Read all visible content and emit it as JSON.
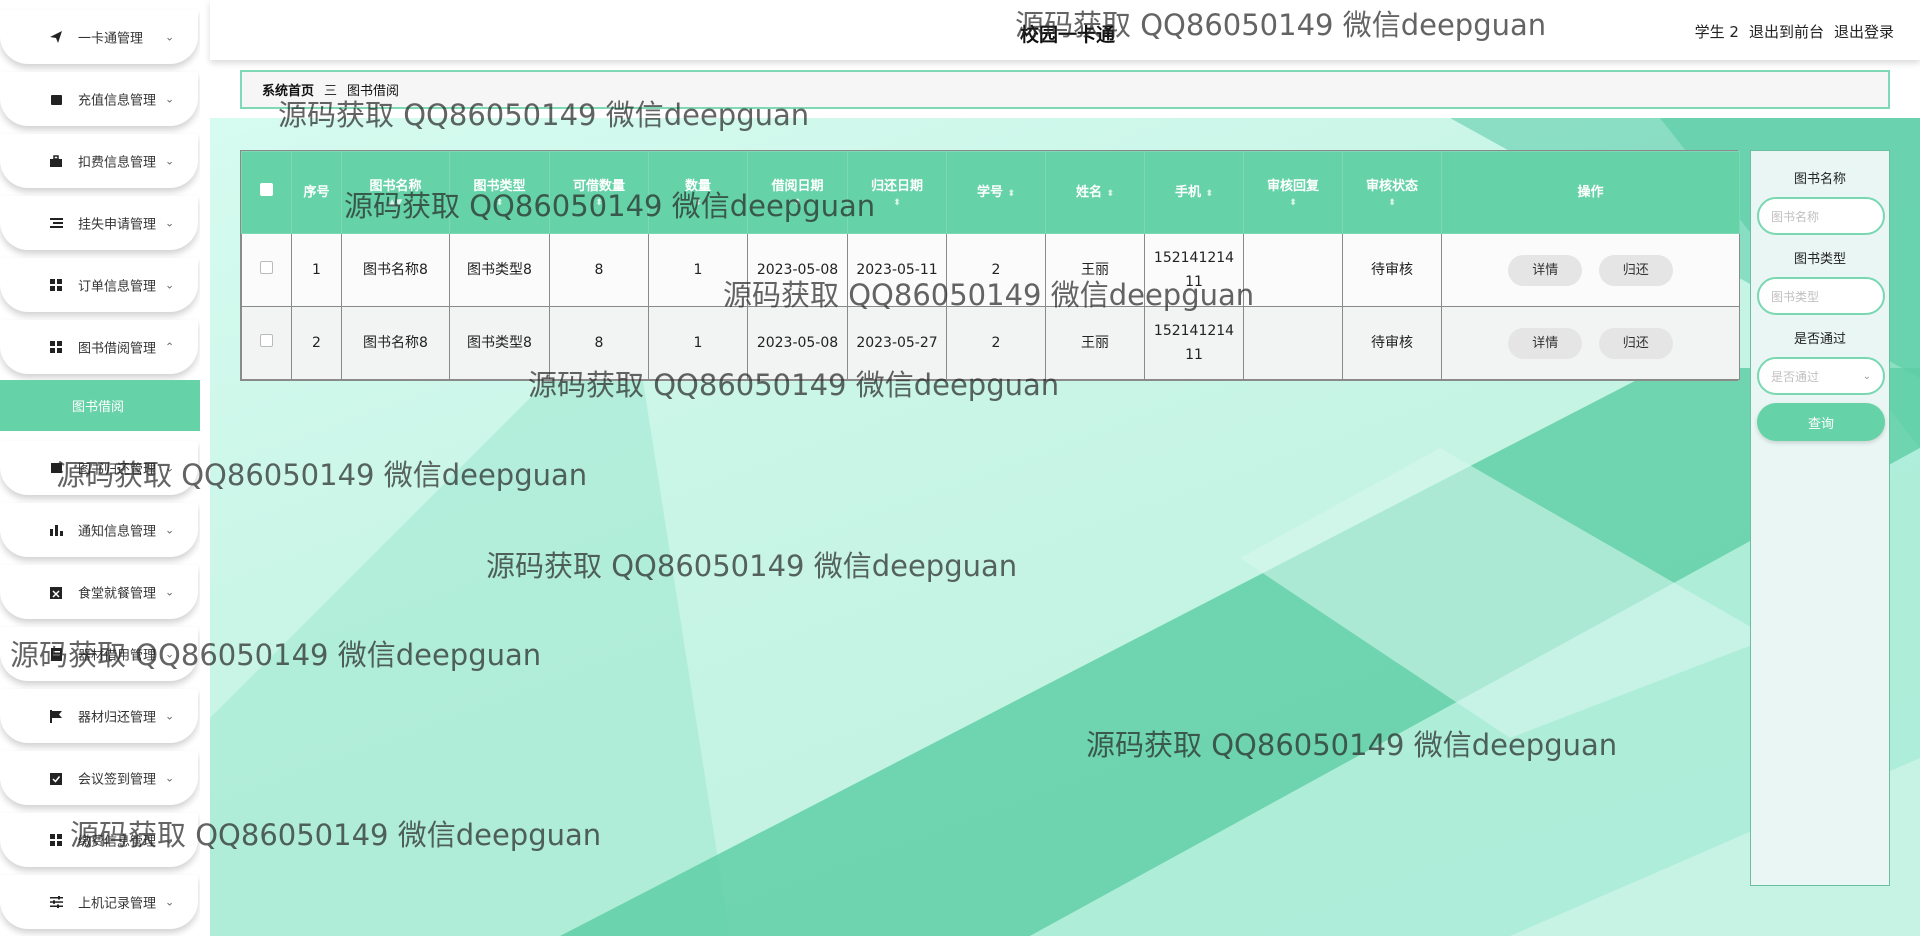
{
  "header": {
    "title": "校园一卡通",
    "user": "学生 2",
    "to_front": "退出到前台",
    "logout": "退出登录"
  },
  "sidebar": {
    "items": [
      {
        "label": "一卡通管理",
        "icon": "send-icon",
        "chevron": "v"
      },
      {
        "label": "充值信息管理",
        "icon": "wallet-icon",
        "chevron": "v"
      },
      {
        "label": "扣费信息管理",
        "icon": "briefcase-icon",
        "chevron": "v"
      },
      {
        "label": "挂失申请管理",
        "icon": "list-icon",
        "chevron": "v"
      },
      {
        "label": "订单信息管理",
        "icon": "grid-icon",
        "chevron": "v"
      },
      {
        "label": "图书借阅管理",
        "icon": "grid-icon",
        "chevron": "^"
      },
      {
        "label": "图书归还管理",
        "icon": "book-icon",
        "chevron": "v"
      },
      {
        "label": "通知信息管理",
        "icon": "bar-chart-icon",
        "chevron": "v"
      },
      {
        "label": "食堂就餐管理",
        "icon": "clipboard-x-icon",
        "chevron": "v"
      },
      {
        "label": "器材借用管理",
        "icon": "doc-icon",
        "chevron": "v"
      },
      {
        "label": "器材归还管理",
        "icon": "flag-icon",
        "chevron": "v"
      },
      {
        "label": "会议签到管理",
        "icon": "clipboard-check-icon",
        "chevron": "v"
      },
      {
        "label": "缴费信息管理",
        "icon": "grid-icon",
        "chevron": "v"
      },
      {
        "label": "上机记录管理",
        "icon": "sliders-icon",
        "chevron": "v"
      }
    ],
    "active_sub": "图书借阅"
  },
  "breadcrumb": {
    "home": "系统首页",
    "sep": "三",
    "current": "图书借阅"
  },
  "table": {
    "headers": [
      "序号",
      "图书名称",
      "图书类型",
      "可借数量",
      "数量",
      "借阅日期",
      "归还日期",
      "学号",
      "姓名",
      "手机",
      "审核回复",
      "审核状态",
      "操作"
    ],
    "rows": [
      {
        "no": "1",
        "name": "图书名称8",
        "type": "图书类型8",
        "available": "8",
        "qty": "1",
        "borrow_date": "2023-05-08",
        "return_date": "2023-05-11",
        "student_no": "2",
        "student_name": "王丽",
        "phone_a": "152141214",
        "phone_b": "11",
        "reply": "",
        "status": "待审核"
      },
      {
        "no": "2",
        "name": "图书名称8",
        "type": "图书类型8",
        "available": "8",
        "qty": "1",
        "borrow_date": "2023-05-08",
        "return_date": "2023-05-27",
        "student_no": "2",
        "student_name": "王丽",
        "phone_a": "152141214",
        "phone_b": "11",
        "reply": "",
        "status": "待审核"
      }
    ],
    "detail_btn": "详情",
    "return_btn": "归还"
  },
  "search": {
    "name_label": "图书名称",
    "name_placeholder": "图书名称",
    "type_label": "图书类型",
    "type_placeholder": "图书类型",
    "pass_label": "是否通过",
    "pass_placeholder": "是否通过",
    "query_btn": "查询"
  },
  "watermark": "源码获取 QQ86050149 微信deepguan",
  "colors": {
    "accent": "#66d2a8",
    "accent_border": "#7fd9b6",
    "background": "#c8f5e6"
  }
}
